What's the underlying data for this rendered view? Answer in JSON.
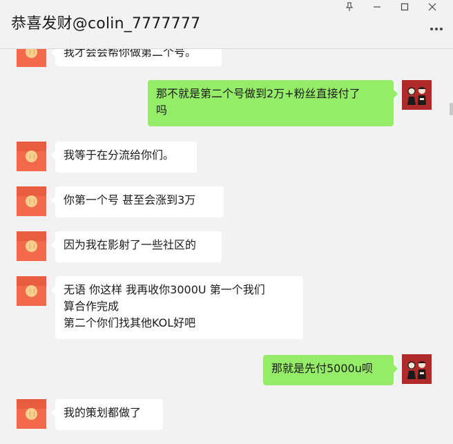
{
  "header": {
    "title": "恭喜发财@colin_7777777",
    "pin_icon": "pin-icon",
    "minimize_icon": "minimize-icon",
    "maximize_icon": "maximize-icon",
    "close_icon": "close-icon",
    "more_icon": "more-icon"
  },
  "colors": {
    "incoming_bubble": "#ffffff",
    "outgoing_bubble": "#95ec69",
    "contact_avatar": "#f26a4b",
    "background": "#f2f2f2"
  },
  "messages": [
    {
      "side": "in",
      "text": "我才会会帮你做第二个号。"
    },
    {
      "side": "out",
      "text": "那不就是第二个号做到2万+粉丝直接付了\n吗"
    },
    {
      "side": "in",
      "text": "我等于在分流给你们。"
    },
    {
      "side": "in",
      "text": "你第一个号 甚至会涨到3万"
    },
    {
      "side": "in",
      "text": "因为我在影射了一些社区的"
    },
    {
      "side": "in",
      "text": "无语  你这样  我再收你3000U 第一个我们\n算合作完成\n第二个你们找其他KOL好吧"
    },
    {
      "side": "out",
      "text": "那就是先付5000u呗"
    },
    {
      "side": "in",
      "text": "我的策划都做了"
    }
  ]
}
